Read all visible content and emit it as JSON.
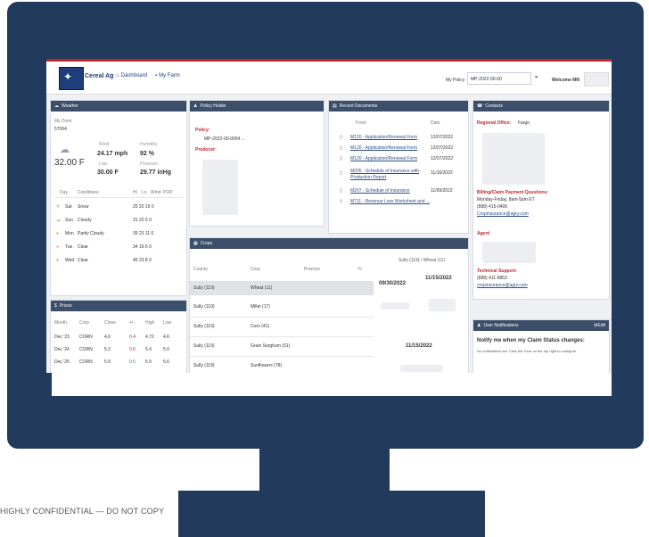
{
  "app": {
    "brand": "Cereal Ag",
    "nav": [
      "Dashboard",
      "My Farm"
    ],
    "policy_label": "My Policy",
    "policy_value": "MP-2022-00-00",
    "welcome": "Welcome MN"
  },
  "weather": {
    "header": "Weather",
    "city_label": "My Zone",
    "city_value": "57064",
    "temp": "32.00 F",
    "wind_label": "Wind",
    "wind_value": "24.17 mph",
    "humidity_label": "Humidity",
    "humidity_value": "92 %",
    "low_label": "Low",
    "low_value": "30.00 F",
    "pressure_label": "Pressure",
    "pressure_value": "29.77 inHg",
    "forecast_headers": [
      "Day",
      "Conditions",
      "Hi",
      "Lo",
      "Wind",
      "POP"
    ],
    "forecast": [
      {
        "day": "Sat",
        "cond": "Snow",
        "vals": "25  20  19  0"
      },
      {
        "day": "Sun",
        "cond": "Cloudy",
        "vals": "31  22  5  0"
      },
      {
        "day": "Mon",
        "cond": "Partly Cloudy",
        "vals": "39  23  11  0"
      },
      {
        "day": "Tue",
        "cond": "Clear",
        "vals": "34  16  6  0"
      },
      {
        "day": "Wed",
        "cond": "Clear",
        "vals": "45  23  8  0"
      }
    ]
  },
  "prices": {
    "header": "Prices",
    "headers": [
      "Month",
      "Crop",
      "Close",
      "+/-",
      "High",
      "Low"
    ],
    "rows": [
      {
        "month": "Dec '23",
        "crop": "CORN",
        "close": "4.6",
        "chg": "0.4",
        "high": "4.72",
        "low": "4.6"
      },
      {
        "month": "Dec '24",
        "crop": "CORN",
        "close": "5.2",
        "chg": "0.6",
        "high": "5.4",
        "low": "5.0"
      },
      {
        "month": "Dec '25",
        "crop": "CORN",
        "close": "5.9",
        "chg": "0.5",
        "high": "5.9",
        "low": "5.6"
      }
    ]
  },
  "policy_holder": {
    "header": "Policy Holder",
    "policy_label": "Policy:",
    "policy_value": "MP-2022-00-0004 ...",
    "producer_label": "Producer:"
  },
  "crops": {
    "header": "Crops",
    "headers": [
      "County",
      "Crop",
      "Practice",
      "Yr",
      "Sully (119) / Wheat (11)"
    ],
    "rows": [
      {
        "county": "Sully (119)",
        "crop": "Wheat (11)",
        "date_a": "09/30/2022",
        "date_b": "11/15/2022"
      },
      {
        "county": "Sully (119)",
        "crop": "Millet (17)",
        "date_a": "",
        "date_b": ""
      },
      {
        "county": "Sully (119)",
        "crop": "Corn (41)",
        "date_a": "",
        "date_b": ""
      },
      {
        "county": "Sully (119)",
        "crop": "Grain Sorghum (51)",
        "date_a": "",
        "date_b": "11/15/2022"
      },
      {
        "county": "Sully (119)",
        "crop": "Sunflowers (78)",
        "date_a": "",
        "date_b": ""
      }
    ]
  },
  "documents": {
    "header": "Recent Documents",
    "headers": [
      "Form",
      "Date"
    ],
    "rows": [
      {
        "form": "M120 - Application/Renewal Form",
        "date": "12/07/2022"
      },
      {
        "form": "M120 - Application/Renewal Form",
        "date": "12/07/2022"
      },
      {
        "form": "M120 - Application/Renewal Form",
        "date": "12/07/2022"
      },
      {
        "form": "M205 - Schedule of Insurance with Production Report",
        "date": "11/16/2022"
      },
      {
        "form": "M207 - Schedule of Insurance",
        "date": "11/09/2022"
      },
      {
        "form": "M711 - Revenue Loss Worksheet and ...",
        "date": ""
      }
    ]
  },
  "contacts": {
    "header": "Contacts",
    "regional_label": "Regional Office:",
    "regional_value": "Fargo",
    "billing_label": "Billing/Claim Payment Questions:",
    "billing_hours": "Monday-Friday, 8am-5pm ET",
    "billing_phone": "(888) 415-0406",
    "billing_email": "Cropinsurance@agry.com",
    "agent_label": "Agent",
    "tech_label": "Technical Support:",
    "tech_phone": "(888) 411-8853",
    "tech_email": "cropinsurance@agry.com"
  },
  "notifications": {
    "header": "User Notifications",
    "edit": "Edit",
    "title": "Notify me when my Claim Status changes:",
    "body": "No notifications set. Click the Gear on the top right to configure."
  },
  "footer": {
    "confidential": "HIGHLY CONFIDENTIAL — DO NOT COPY"
  },
  "colors": {
    "frame": "#223a5c",
    "panel_header": "#3b4f6b",
    "accent_red": "#c0272d"
  }
}
